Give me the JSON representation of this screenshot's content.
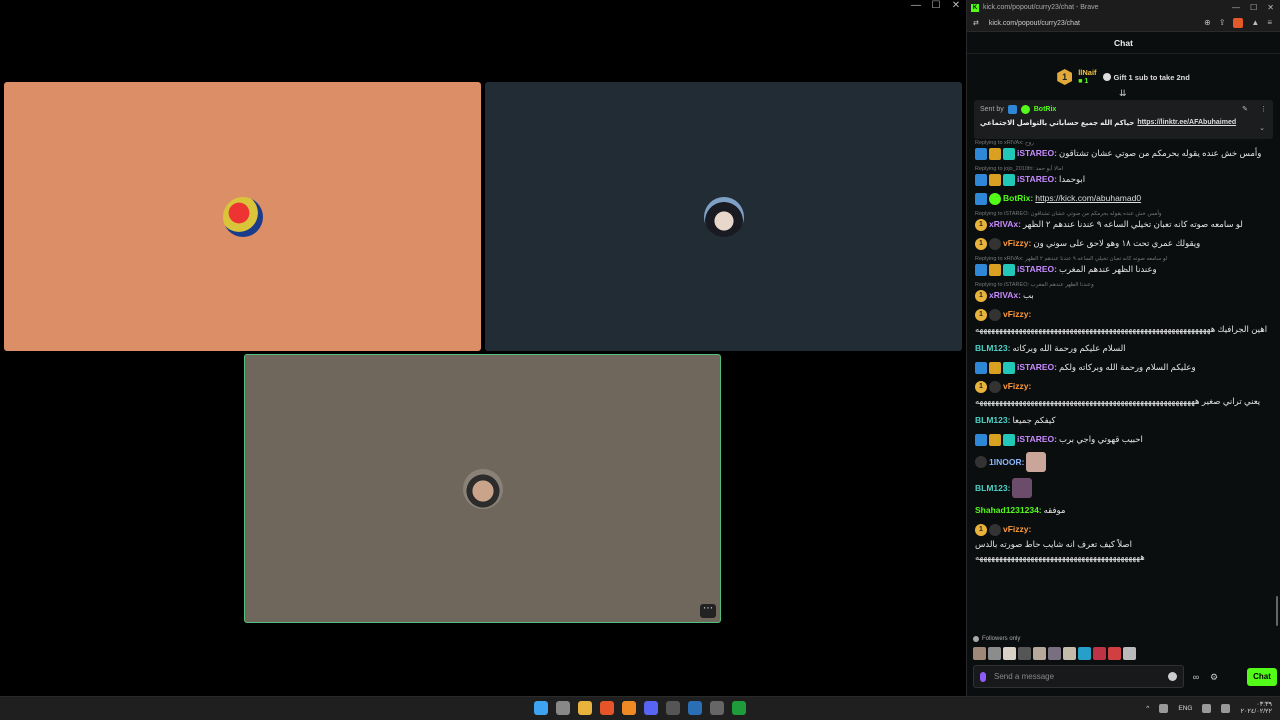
{
  "browser": {
    "window_title": "kick.com/popout/curry23/chat - Brave",
    "url": "kick.com/popout/curry23/chat"
  },
  "window_controls": {
    "minimize": "—",
    "maximize": "☐",
    "close": "✕"
  },
  "chat": {
    "header": "Chat",
    "gift": {
      "badge": "1",
      "user": "llNaif",
      "count": "1",
      "cta": "Gift 1 sub to take 2nd"
    },
    "pinned": {
      "sent_by": "Sent by",
      "bot_name": "BotRix",
      "text": "حياكم الله جميع حساباتي بالتواصل الاجتماعي",
      "link": "https://linktr.ee/AFAbuhaimed"
    },
    "messages": [
      {
        "reply": "Replying to xRIVAx: روح",
        "user": "iSTAREO",
        "color": "#c78bff",
        "badges": [
          "axe",
          "crown",
          "tv"
        ],
        "text": "وأمس خش عنده يقوله بحرمكم من صوتي عشان تشتاقون"
      },
      {
        "reply": "Replying to jojo_2010fri: امالا أبو حمد",
        "user": "iSTAREO",
        "color": "#c78bff",
        "badges": [
          "axe",
          "crown",
          "tv"
        ],
        "text": "ابوحمدا"
      },
      {
        "reply": "",
        "user": "BotRix",
        "color": "#53fc18",
        "badges": [
          "axe",
          "ver"
        ],
        "text": "",
        "link": "https://kick.com/abuhamad0"
      },
      {
        "reply": "Replying to iSTAREO: وأمس خش عنده يقوله بحرمكم من صوتي عشان تشتاقون",
        "user": "xRIVAx",
        "color": "#c78bff",
        "badges": [
          "gold"
        ],
        "text": "لو سامعه صوته كانه تعبان تخيلي الساعه ٩ عندنا عندهم ٢ الظهر"
      },
      {
        "reply": "",
        "user": "vFizzy",
        "color": "#ff9a3d",
        "badges": [
          "gold",
          "hammer"
        ],
        "text": "ويقولك عمري تحت ١٨ وهو لاحق على سوني ون"
      },
      {
        "reply": "Replying to xRIVAx: لو سامعه صوته كانه تعبان تخيلي الساعه ٩ عندنا عندهم ٢ الظهر",
        "user": "iSTAREO",
        "color": "#c78bff",
        "badges": [
          "axe",
          "crown",
          "tv"
        ],
        "text": "وعندنا الظهر عندهم المغرب"
      },
      {
        "reply": "Replying to iSTAREO: وعندنا الظهر عندهم المغرب",
        "user": "xRIVAx",
        "color": "#c78bff",
        "badges": [
          "gold"
        ],
        "text": "بب"
      },
      {
        "reply": "",
        "user": "vFizzy",
        "color": "#ff9a3d",
        "badges": [
          "gold",
          "hammer"
        ],
        "text": "اهين الجرافيك ههههههههههههههههههههههههههههههههههههههههههههههههههههههههههههه"
      },
      {
        "reply": "",
        "user": "BLM123",
        "color": "#4fd1c5",
        "badges": [],
        "text": "السلام عليكم ورحمة الله وبركاته"
      },
      {
        "reply": "",
        "user": "iSTAREO",
        "color": "#c78bff",
        "badges": [
          "axe",
          "crown",
          "tv"
        ],
        "text": "وعليكم السلام ورحمة الله وبركاته ولكم"
      },
      {
        "reply": "",
        "user": "vFizzy",
        "color": "#ff9a3d",
        "badges": [
          "gold",
          "hammer"
        ],
        "text": "يعني تراني صغير ههههههههههههههههههههههههههههههههههههههههههههههههههههههههه"
      },
      {
        "reply": "",
        "user": "BLM123",
        "color": "#4fd1c5",
        "badges": [],
        "text": "كيفكم جميعا"
      },
      {
        "reply": "",
        "user": "iSTAREO",
        "color": "#c78bff",
        "badges": [
          "axe",
          "crown",
          "tv"
        ],
        "text": "احبيب قهوتي واجي برب"
      },
      {
        "reply": "",
        "user": "1INOOR",
        "color": "#8ab4f8",
        "badges": [
          "hammer"
        ],
        "text": "",
        "emote": "#caa59a"
      },
      {
        "reply": "",
        "user": "BLM123",
        "color": "#4fd1c5",
        "badges": [],
        "text": "",
        "emote": "#6b4c6a"
      },
      {
        "reply": "",
        "user": "Shahad1231234",
        "color": "#53fc18",
        "badges": [],
        "text": "موفقه"
      },
      {
        "reply": "",
        "user": "vFizzy",
        "color": "#ff9a3d",
        "badges": [
          "gold",
          "hammer"
        ],
        "text": "اصلاً كيف تعرف انه شايب حاط صورته بالدس ههههههههههههههههههههههههههههههههههههههههههه"
      }
    ],
    "followers_only": "Followers only",
    "input_placeholder": "Send a message",
    "chat_button": "Chat"
  },
  "taskbar": {
    "lang": "ENG",
    "time": "٠٣:٣٩",
    "date": "٢٠٢٤/٠٢/٢٢"
  },
  "colors": {
    "kick_green": "#53fc18",
    "tile1": "#dc8e66",
    "tile2": "#222c35",
    "tile3": "#70675c"
  }
}
